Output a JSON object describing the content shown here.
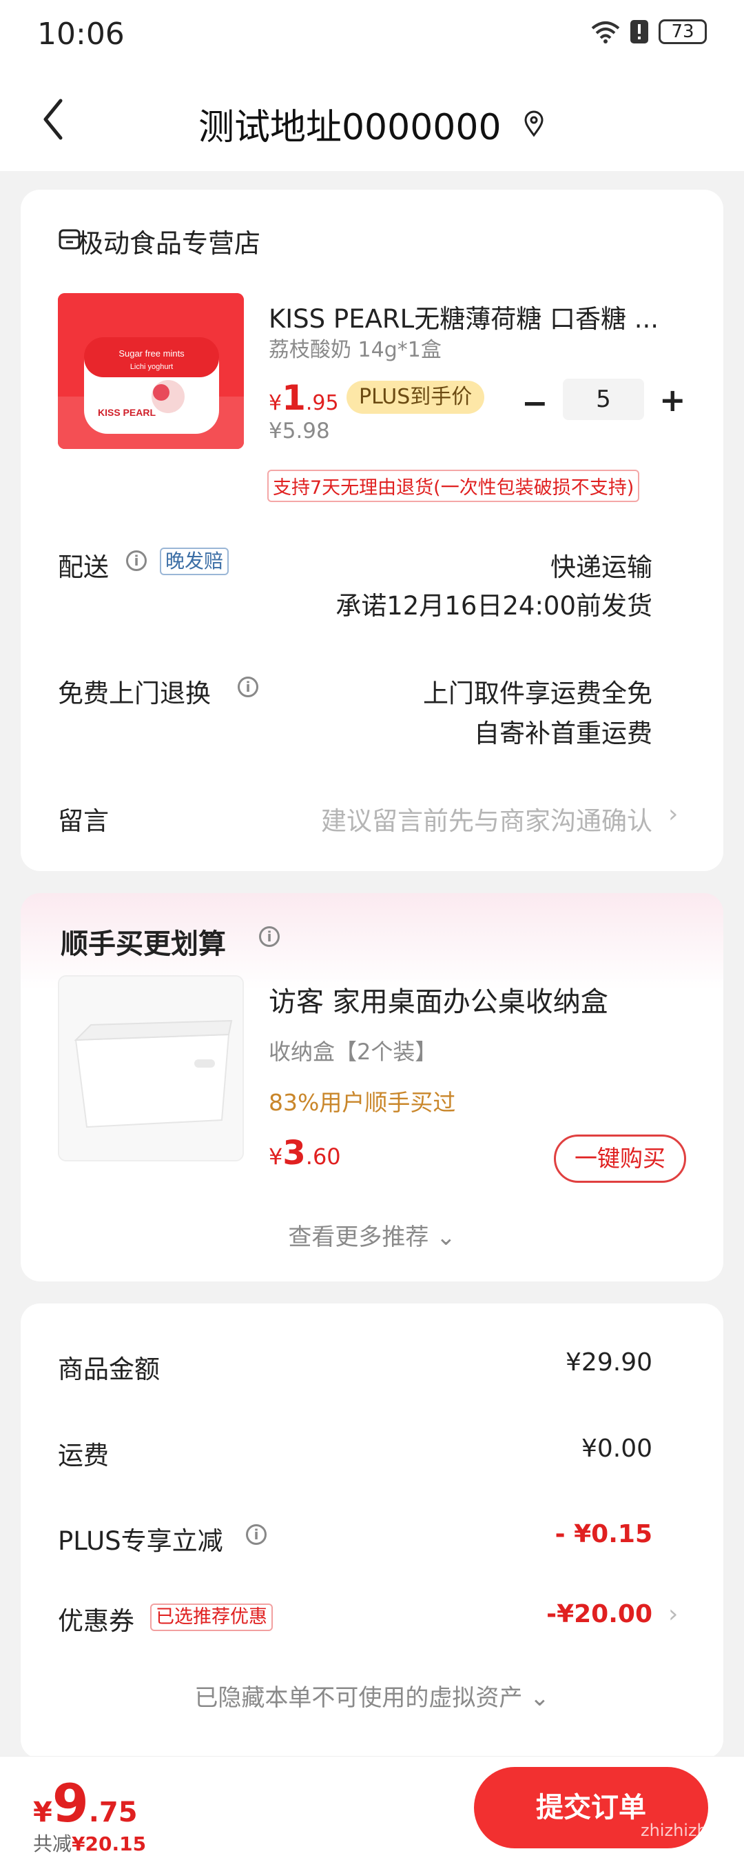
{
  "status_bar": {
    "time": "10:06",
    "battery": "73"
  },
  "header": {
    "address": "测试地址0000000"
  },
  "store": {
    "name": "极动食品专营店",
    "product": {
      "title": "KISS PEARL无糖薄荷糖 口香糖 ...",
      "spec": "荔枝酸奶 14g*1盒",
      "price_currency": "¥",
      "price_int": "1",
      "price_dec": ".95",
      "plus_label": "PLUS到手价",
      "original_price": "¥5.98",
      "quantity": "5",
      "return_policy": "支持7天无理由退货(一次性包装破损不支持)",
      "image_text": {
        "brand": "KISS PEARL",
        "tagline": "Sugar free mints",
        "flavor": "Lichi yoghurt"
      }
    },
    "delivery": {
      "label": "配送",
      "tag": "晚发赔",
      "method": "快递运输",
      "promise": "承诺12月16日24:00前发货"
    },
    "return_service": {
      "label": "免费上门退换",
      "line1": "上门取件享运费全免",
      "line2": "自寄补首重运费"
    },
    "message": {
      "label": "留言",
      "placeholder": "建议留言前先与商家沟通确认"
    }
  },
  "recommend": {
    "title": "顺手买更划算",
    "item": {
      "name": "访客 家用桌面办公桌收纳盒",
      "spec": "收纳盒【2个装】",
      "bought": "83%用户顺手买过",
      "price_currency": "¥",
      "price_int": "3",
      "price_dec": ".60",
      "buy_label": "一键购买"
    },
    "more_label": "查看更多推荐"
  },
  "summary": {
    "goods_label": "商品金额",
    "goods_value": "¥29.90",
    "shipping_label": "运费",
    "shipping_value": "¥0.00",
    "plus_label": "PLUS专享立减",
    "plus_value": "- ¥0.15",
    "coupon_label": "优惠券",
    "coupon_tag": "已选推荐优惠",
    "coupon_value": "-¥20.00",
    "hidden_label": "已隐藏本单不可使用的虚拟资产"
  },
  "bottom": {
    "total_currency": "¥",
    "total_int": "9",
    "total_dec": ".75",
    "saved_label": "共减",
    "saved_value": "¥20.15",
    "submit_label": "提交订单",
    "watermark": "zhizhizhi.com"
  },
  "colors": {
    "accent_red": "#e02020",
    "button_red": "#f23030",
    "plus_gold": "#fde7a7"
  }
}
